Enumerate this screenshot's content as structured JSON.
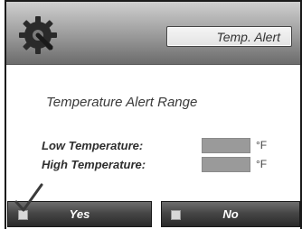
{
  "header": {
    "icon": "gear-icon",
    "title": "Temp. Alert"
  },
  "section": {
    "title": "Temperature Alert Range"
  },
  "fields": {
    "low_label": "Low Temperature:",
    "low_value": "",
    "low_unit": "°F",
    "high_label": "High Temperature:",
    "high_value": "",
    "high_unit": "°F"
  },
  "buttons": {
    "yes_label": "Yes",
    "no_label": "No",
    "selected": "Yes"
  },
  "colors": {
    "header_dark": "#6c6c6c",
    "button_dark": "#2a2a2a",
    "field_gray": "#9a9a9a"
  }
}
